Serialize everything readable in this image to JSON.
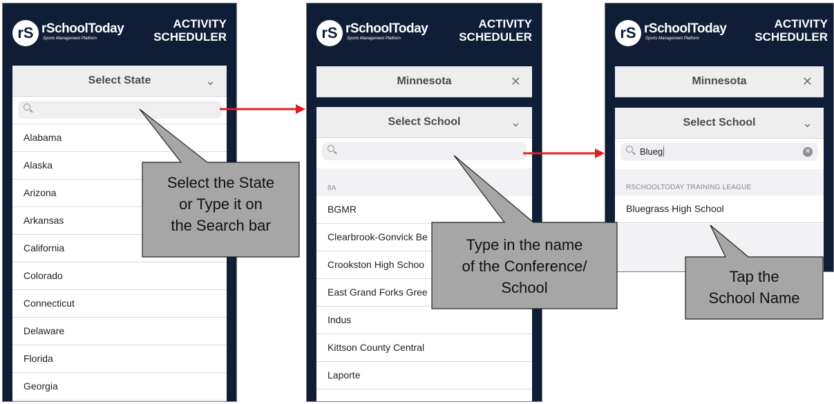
{
  "brand": {
    "logo_text": "rSchoolToday",
    "logo_sub": "Sports Management Platform",
    "title_line1": "ACTIVITY",
    "title_line2": "SCHEDULER"
  },
  "screen1": {
    "dropdown_label": "Select State",
    "search_value": "",
    "states": [
      "Alabama",
      "Alaska",
      "Arizona",
      "Arkansas",
      "California",
      "Colorado",
      "Connecticut",
      "Delaware",
      "Florida",
      "Georgia"
    ]
  },
  "screen2": {
    "state_label": "Minnesota",
    "school_dropdown_label": "Select School",
    "search_value": "",
    "section_header": "8A",
    "schools": [
      "BGMR",
      "Clearbrook-Gonvick Be",
      "Crookston High Schoo",
      "East Grand Forks Gree",
      "Indus",
      "Kittson County Central",
      "Laporte"
    ]
  },
  "screen3": {
    "state_label": "Minnesota",
    "school_dropdown_label": "Select School",
    "search_value": "Blueg",
    "section_header": "RSCHOOLTODAY TRAINING LEAGUE",
    "result": "Bluegrass High School"
  },
  "callouts": {
    "one": [
      "Select the State",
      "or Type it on",
      "the Search bar"
    ],
    "two": [
      "Type in the name",
      "of the Conference/",
      "School"
    ],
    "three": [
      "Tap the",
      "School Name"
    ]
  },
  "colors": {
    "header_bg": "#0f1e36",
    "callout_fill": "#a6a6a6",
    "arrow": "#e02020"
  }
}
